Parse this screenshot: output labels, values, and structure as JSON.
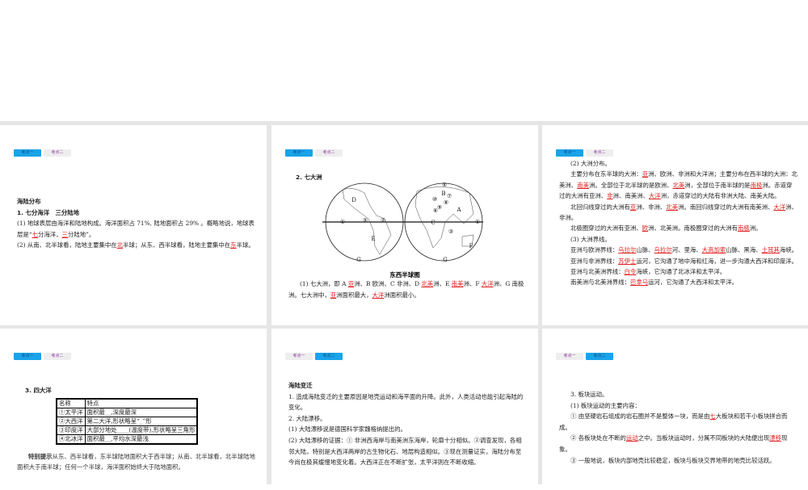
{
  "tabs": [
    "考点一",
    "考点二"
  ],
  "s1": {
    "title": "海陆分布",
    "paras": [
      [
        {
          "t": "1. 七分海洋　三分陆地",
          "b": 1
        }
      ],
      [
        {
          "t": "(1) 地球表层由海洋和陆地构成。海洋面积占 71%, 陆地面积占 29% 。概略地说，地球表层是“"
        },
        {
          "t": "七",
          "r": 1
        },
        {
          "t": "分海洋，"
        },
        {
          "t": "三",
          "r": 1
        },
        {
          "t": "分陆地”。"
        }
      ],
      [
        {
          "t": "(2) 从南、北半球看，陆地主要集中在"
        },
        {
          "t": "北",
          "r": 1
        },
        {
          "t": "半球；从东、西半球看，陆地主要集中在"
        },
        {
          "t": "东",
          "r": 1
        },
        {
          "t": "半球。"
        }
      ]
    ]
  },
  "s2": {
    "heading": "2. 七大洲",
    "map_caption": "东西半球图",
    "map_labels": [
      "D",
      "①",
      "⑤",
      "②",
      "E",
      "G",
      "④",
      "B",
      "⑦",
      "⑩",
      "⑧",
      "⑨",
      "⑥",
      "A",
      "C",
      "①",
      "③",
      "F",
      "G"
    ],
    "paras": [
      [
        {
          "t": "(1) 七大洲，即 A "
        },
        {
          "t": "亚",
          "r": 1
        },
        {
          "t": "洲、B 欧洲、C 非洲、D "
        },
        {
          "t": "北美",
          "r": 1
        },
        {
          "t": "洲、E "
        },
        {
          "t": "南美",
          "r": 1
        },
        {
          "t": "洲、F "
        },
        {
          "t": "大洋",
          "r": 1
        },
        {
          "t": "洲、G 南极洲。七大洲中，"
        },
        {
          "t": "亚",
          "r": 1
        },
        {
          "t": "洲面积最大，"
        },
        {
          "t": "大洋",
          "r": 1
        },
        {
          "t": "洲面积最小。"
        }
      ]
    ]
  },
  "s3": {
    "paras": [
      [
        {
          "t": "(2) 大洲分布。"
        }
      ],
      [
        {
          "t": "主要分布在东半球的大洲："
        },
        {
          "t": "亚",
          "r": 1
        },
        {
          "t": "洲、欧洲、非洲和大洋洲；主要分布在西半球的大洲：北美洲、"
        },
        {
          "t": "南美",
          "r": 1
        },
        {
          "t": "洲。全部位于北半球的是欧洲、"
        },
        {
          "t": "北美",
          "r": 1
        },
        {
          "t": "洲，全部位于南半球的是"
        },
        {
          "t": "南极",
          "r": 1
        },
        {
          "t": "洲。赤道穿过的大洲有亚洲、"
        },
        {
          "t": "非",
          "r": 1
        },
        {
          "t": "洲、南美洲、"
        },
        {
          "t": "大洋",
          "r": 1
        },
        {
          "t": "洲，赤道穿过的大陆有非洲大陆、南美大陆。"
        }
      ],
      [
        {
          "t": "北回归线穿过的大洲有"
        },
        {
          "t": "亚",
          "r": 1
        },
        {
          "t": "洲、非洲、"
        },
        {
          "t": "北美",
          "r": 1
        },
        {
          "t": "洲。南回归线穿过的大洲有南美洲、"
        },
        {
          "t": "大洋",
          "r": 1
        },
        {
          "t": "洲、非洲。"
        }
      ],
      [
        {
          "t": "北极圈穿过的大洲有亚洲、"
        },
        {
          "t": "欧",
          "r": 1
        },
        {
          "t": "洲、北美洲。南极圈穿过的大洲有"
        },
        {
          "t": "南极",
          "r": 1
        },
        {
          "t": "洲。"
        }
      ],
      [
        {
          "t": "(3) 大洲界线。"
        }
      ],
      [
        {
          "t": "亚洲与欧洲界线："
        },
        {
          "t": "乌拉尔",
          "r": 1
        },
        {
          "t": "山脉、"
        },
        {
          "t": "乌拉尔",
          "r": 1
        },
        {
          "t": "河、里海、"
        },
        {
          "t": "大高加索",
          "r": 1
        },
        {
          "t": "山脉、黑海、"
        },
        {
          "t": "土耳其",
          "r": 1
        },
        {
          "t": "海峡。"
        }
      ],
      [
        {
          "t": "亚洲与非洲界线："
        },
        {
          "t": "苏伊士",
          "r": 1
        },
        {
          "t": "运河，它沟通了地中海和红海，进一步沟通大西洋和印度洋。"
        }
      ],
      [
        {
          "t": "亚洲与北美洲界线："
        },
        {
          "t": "白令",
          "r": 1
        },
        {
          "t": "海峡，它沟通了北冰洋和太平洋。"
        }
      ],
      [
        {
          "t": "南美洲与北美洲界线："
        },
        {
          "t": "巴拿马",
          "r": 1
        },
        {
          "t": "运河，它沟通了大西洋和太平洋。"
        }
      ]
    ]
  },
  "s4": {
    "heading": "3. 四大洋",
    "table": {
      "headers": [
        "名称",
        "特点"
      ],
      "rows": [
        [
          "①太平洋",
          "面积最__,深度最深"
        ],
        [
          "②大西洋",
          "第二大洋,形状略呈“_”形"
        ],
        [
          "③印度洋",
          "大部分地处____(温度带),形状略呈三角形"
        ],
        [
          "④北冰洋",
          "面积最__,平均水深最浅"
        ]
      ]
    },
    "tip_label": "特别提示",
    "tip": "从东、西半球看，东半球陆地面积大于西半球；从南、北半球看，北半球陆地面积大于南半球；任何一个半球，海洋面积始终大于陆地面积。"
  },
  "s5": {
    "title": "海陆变迁",
    "paras": [
      [
        {
          "t": "1. 造成海陆变迁的主要原因是地壳运动和海平面的升降。此外，人类活动也能引起海陆的变化。"
        }
      ],
      [
        {
          "t": "2. 大陆漂移。"
        }
      ],
      [
        {
          "t": "(1) 大陆漂移说是德国科学家魏格纳提出的。"
        }
      ],
      [
        {
          "t": "(2) 大陆漂移的证据：① 非洲西海岸与南美洲东海岸，轮廓十分相似。②调查发现，各相邻大陆，特别是大西洋两岸的古生物化石、地层构造相似。③现在测量证实，海陆分布至今尚在极其缓慢地变化着。大西洋正在不断扩张，太平洋则在不断收缩。"
        }
      ]
    ]
  },
  "s6": {
    "paras": [
      [
        {
          "t": "3. 板块运动。"
        }
      ],
      [
        {
          "t": "(1) 板块运动的主要内容："
        }
      ],
      [
        {
          "t": "① 由坚硬岩石组成的岩石圈并不是整体一块，而是由"
        },
        {
          "t": "七",
          "r": 1
        },
        {
          "t": "大板块和若干小板块拼合而成。"
        }
      ],
      [
        {
          "t": "② 各板块处在不断的"
        },
        {
          "t": "运动",
          "r": 1
        },
        {
          "t": "之中。当板块运动时，分属不同板块的大陆便出现"
        },
        {
          "t": "漂移",
          "r": 1
        },
        {
          "t": "现象。"
        }
      ],
      [
        {
          "t": "③ 一般地说，板块内部地壳比较稳定，板块与板块交界地带的地壳比较活跃。"
        }
      ]
    ]
  }
}
